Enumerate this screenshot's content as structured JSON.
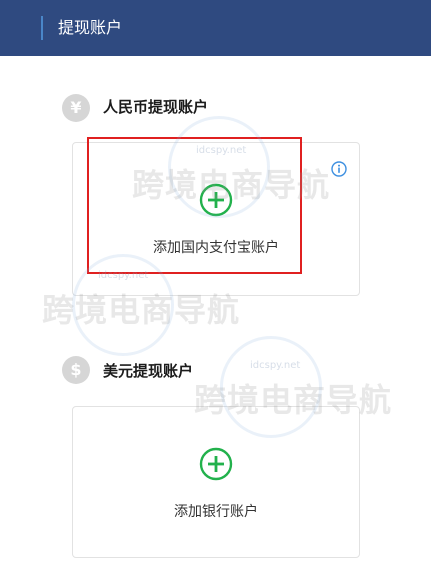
{
  "header": {
    "title": "提现账户"
  },
  "cny_section": {
    "currency_symbol": "¥",
    "title": "人民币提现账户",
    "add_label": "添加国内支付宝账户"
  },
  "usd_section": {
    "currency_symbol": "$",
    "title": "美元提现账户",
    "add_label": "添加银行账户"
  },
  "watermark": {
    "text": "跨境电商导航",
    "url": "idcspy.net"
  },
  "icons": {
    "plus": "plus-circle-icon",
    "info": "info-icon",
    "cny": "yuan-icon",
    "usd": "dollar-icon"
  },
  "colors": {
    "header_bg": "#2f4a80",
    "header_accent": "#4a86c8",
    "plus_green": "#22b14c",
    "info_blue": "#3d8fe0",
    "highlight_red": "#e02020"
  }
}
